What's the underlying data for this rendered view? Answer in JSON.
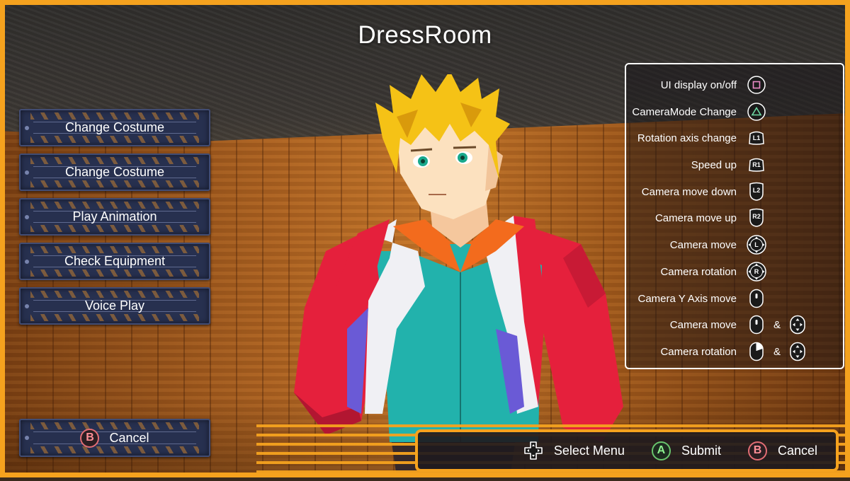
{
  "title": "DressRoom",
  "menu": {
    "items": [
      {
        "label": "Change Costume"
      },
      {
        "label": "Change Costume"
      },
      {
        "label": "Play Animation"
      },
      {
        "label": "Check Equipment"
      },
      {
        "label": "Voice Play"
      }
    ],
    "cancel": {
      "button": "B",
      "label": "Cancel"
    }
  },
  "controls": [
    {
      "label": "UI display on/off",
      "icon": "square-button-icon"
    },
    {
      "label": "CameraMode Change",
      "icon": "triangle-button-icon"
    },
    {
      "label": "Rotation axis change",
      "icon": "l1-button-icon",
      "text": "L1"
    },
    {
      "label": "Speed up",
      "icon": "r1-button-icon",
      "text": "R1"
    },
    {
      "label": "Camera move down",
      "icon": "l2-button-icon",
      "text": "L2"
    },
    {
      "label": "Camera move up",
      "icon": "r2-button-icon",
      "text": "R2"
    },
    {
      "label": "Camera move",
      "icon": "left-stick-icon",
      "text": "L"
    },
    {
      "label": "Camera rotation",
      "icon": "right-stick-icon",
      "text": "R"
    },
    {
      "label": "Camera Y Axis move",
      "icon": "mouse-wheel-icon"
    },
    {
      "label": "Camera move",
      "icon": "mouse-wheel-icon",
      "joiner": "&",
      "icon2": "move-arrows-icon"
    },
    {
      "label": "Camera rotation",
      "icon": "mouse-right-click-icon",
      "joiner": "&",
      "icon2": "move-arrows-icon"
    }
  ],
  "bottom_bar": {
    "select": {
      "label": "Select Menu",
      "icon": "dpad-icon"
    },
    "submit": {
      "label": "Submit",
      "button": "A"
    },
    "cancel": {
      "label": "Cancel",
      "button": "B"
    }
  },
  "colors": {
    "accent": "#f5a21e",
    "panel_border": "#ffffff",
    "menu_plate": "#27304f",
    "button_a": "#69c56d",
    "button_b": "#e26d74"
  }
}
